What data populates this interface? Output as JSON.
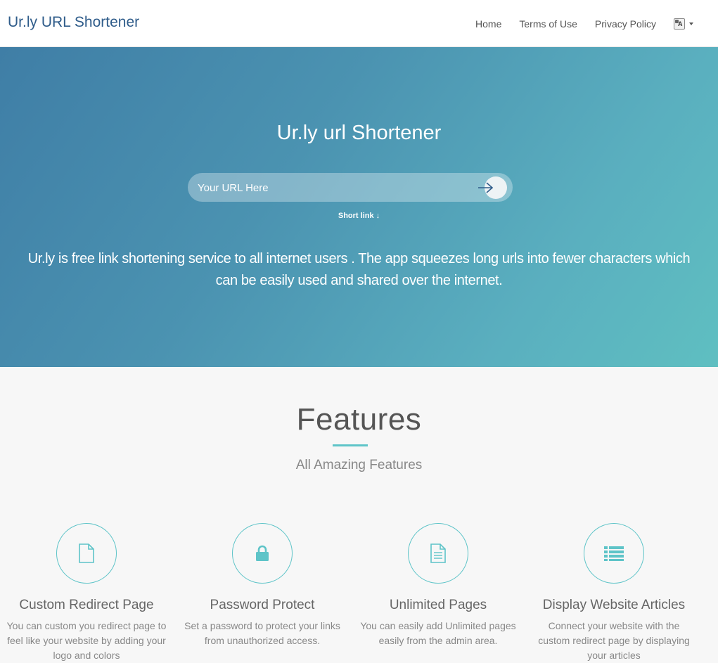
{
  "nav": {
    "brand": "Ur.ly URL Shortener",
    "links": [
      "Home",
      "Terms of Use",
      "Privacy Policy"
    ],
    "language_icon": "translate-icon"
  },
  "hero": {
    "title": "Ur.ly url Shortener",
    "input_placeholder": "Your URL Here",
    "submit_icon": "arrow-right-icon",
    "short_link": "Short link ↓",
    "description_line1": "Ur.ly is free link shortening service to all internet users . The app squeezes long urls into fewer characters which",
    "description_line2": "can be easily used and shared over the internet."
  },
  "features": {
    "title": "Features",
    "subtitle": "All Amazing Features",
    "items": [
      {
        "icon": "file-icon",
        "title": "Custom Redirect Page",
        "text": "You can custom you redirect page to feel like your website by adding your logo and colors"
      },
      {
        "icon": "lock-icon",
        "title": "Password Protect",
        "text": "Set a password to protect your links from unauthorized access."
      },
      {
        "icon": "file-text-icon",
        "title": "Unlimited Pages",
        "text": "You can easily add Unlimited pages easily from the admin area."
      },
      {
        "icon": "list-icon",
        "title": "Display Website Articles",
        "text": "Connect your website with the custom redirect page by displaying your articles"
      }
    ]
  },
  "colors": {
    "accent": "#5ec4c8",
    "brand": "#2f5c8a",
    "hero_start": "#3f7ea6",
    "hero_end": "#5fbfc1"
  }
}
